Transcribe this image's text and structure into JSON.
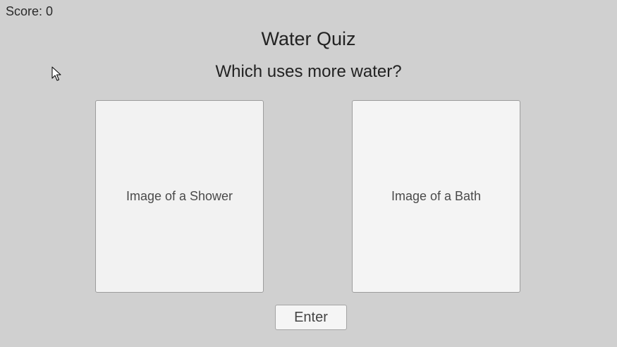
{
  "hud": {
    "score_text": "Score: 0"
  },
  "quiz": {
    "title": "Water Quiz",
    "question": "Which uses more water?",
    "options": [
      {
        "label": "Image of a Shower"
      },
      {
        "label": "Image of a Bath"
      }
    ],
    "submit_label": "Enter"
  },
  "pointer": {
    "icon": "mouse-cursor-icon"
  }
}
